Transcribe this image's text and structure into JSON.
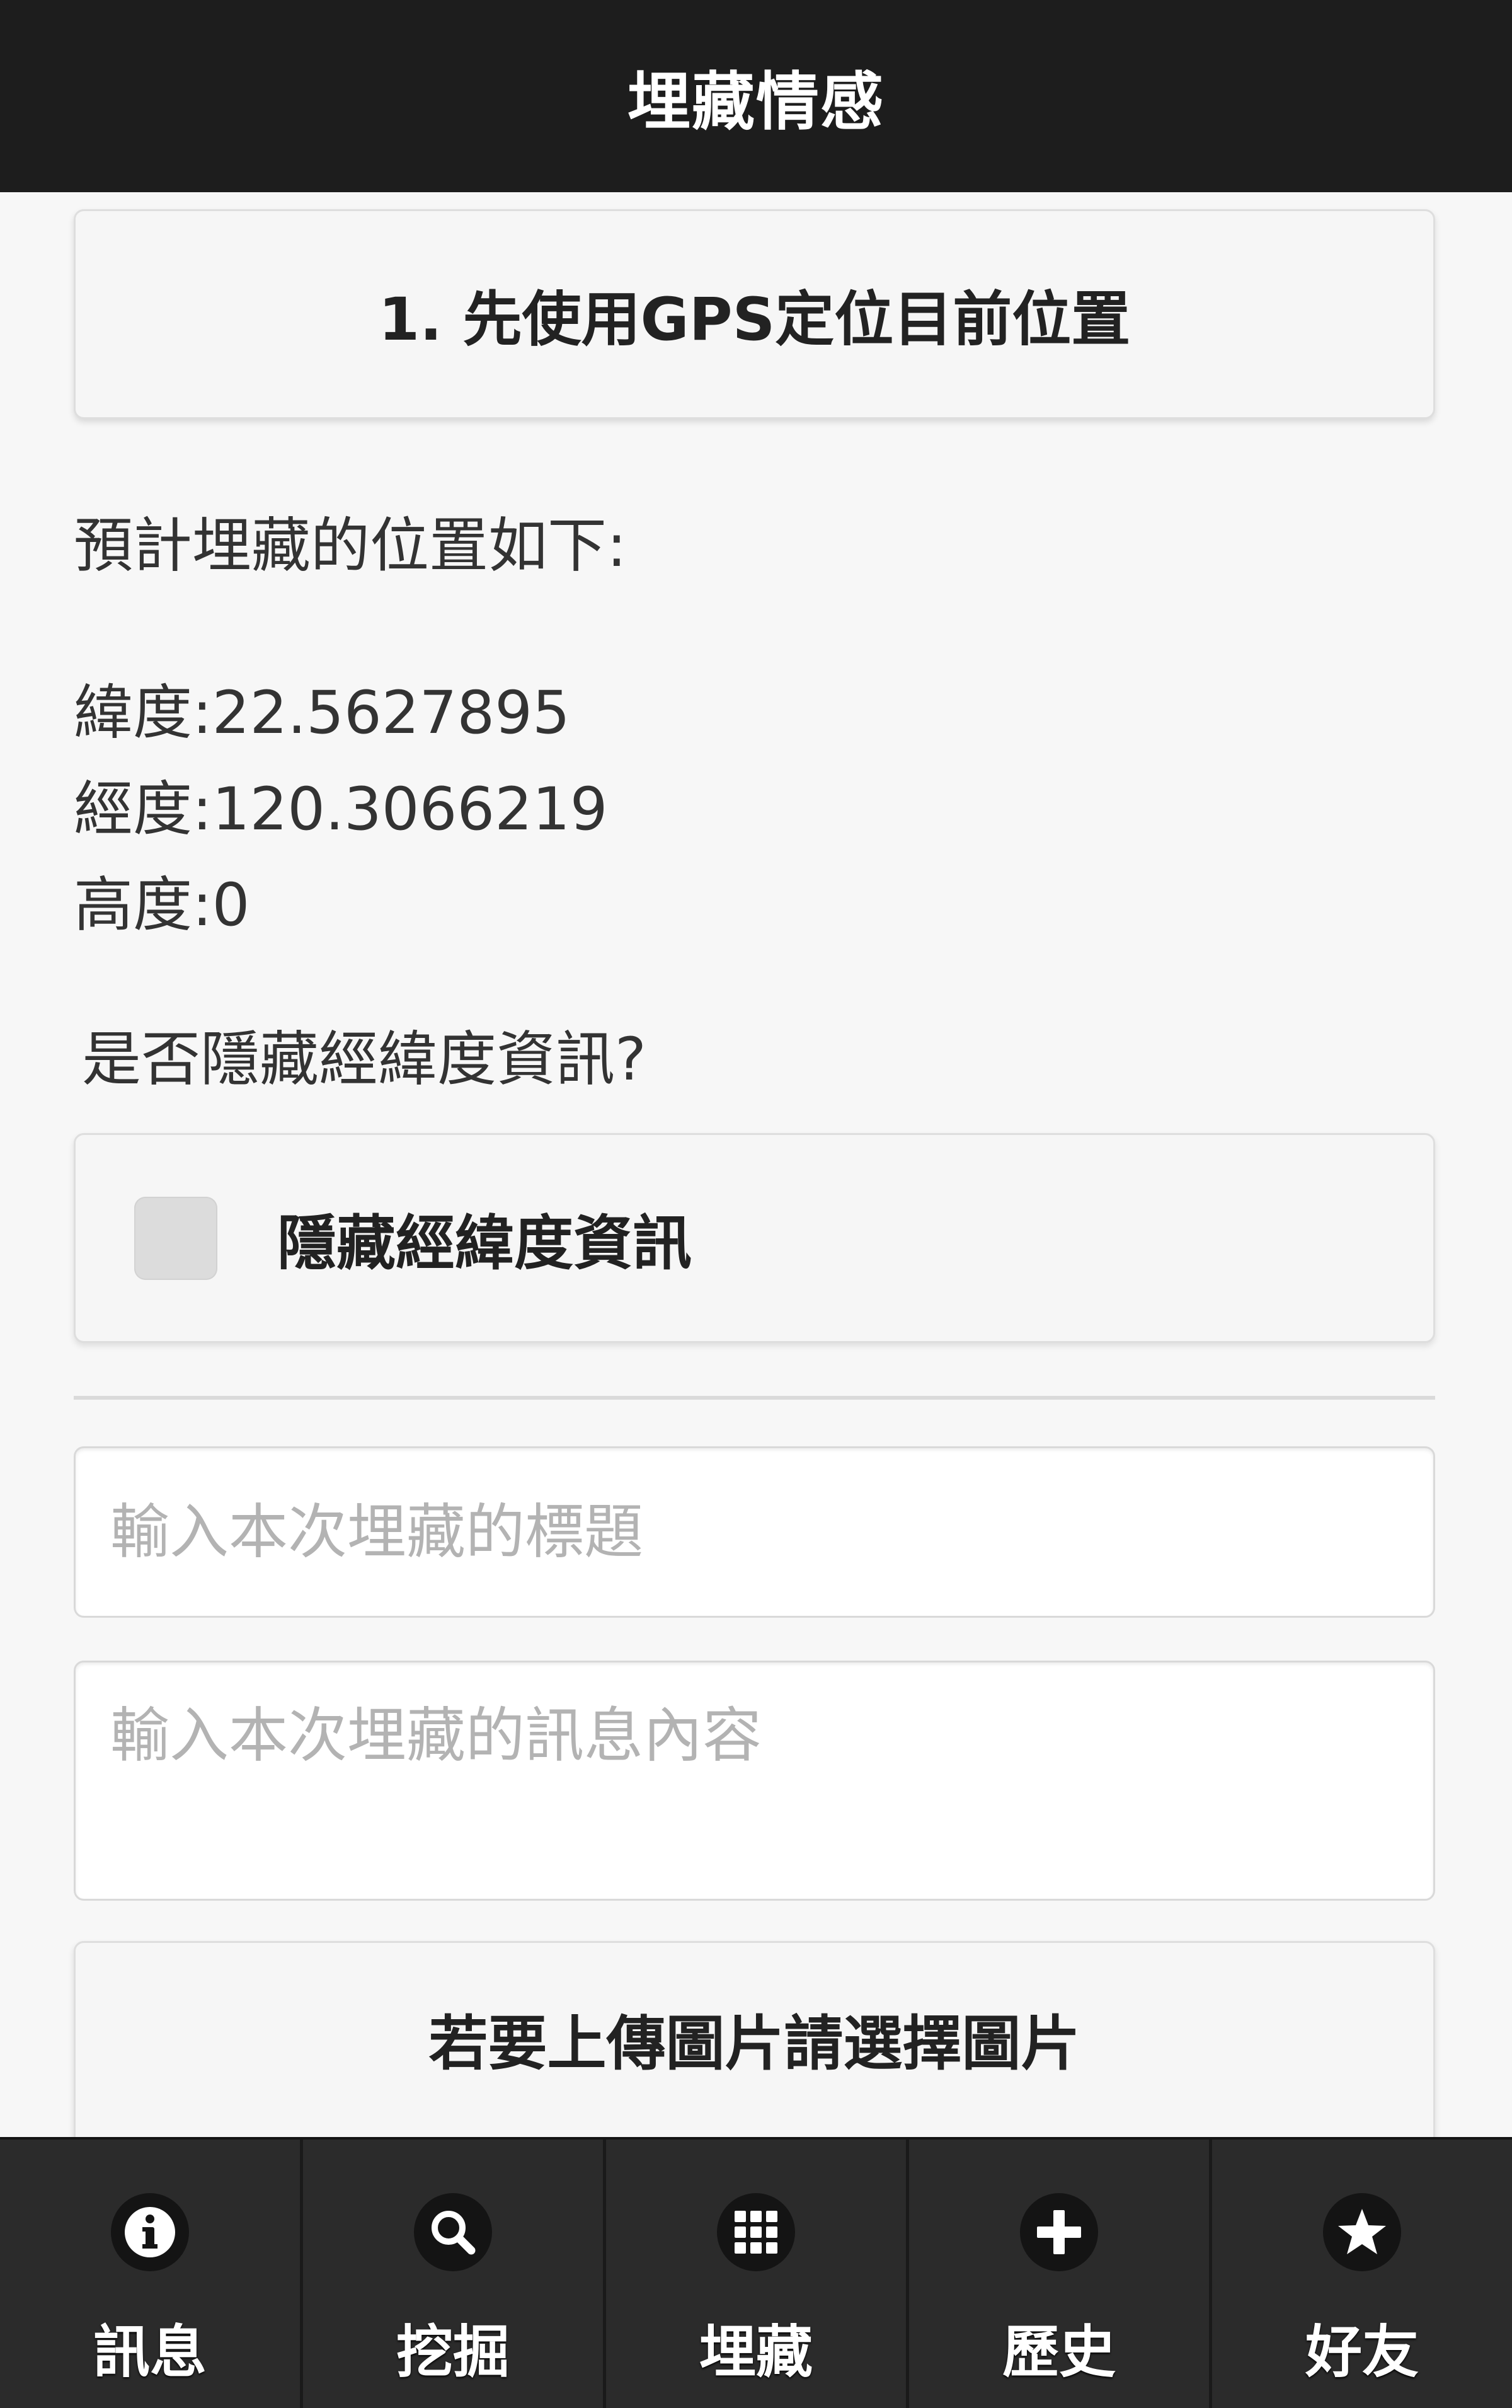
{
  "header": {
    "title": "埋藏情感"
  },
  "gps_button": {
    "label": "1. 先使用GPS定位目前位置"
  },
  "location": {
    "intro": "預計埋藏的位置如下:",
    "latitude": "緯度:22.5627895",
    "longitude": "經度:120.3066219",
    "altitude": "高度:0"
  },
  "hide_option": {
    "question": "是否隱藏經緯度資訊?",
    "checkbox_label": "隱藏經緯度資訊",
    "checked": false
  },
  "form": {
    "title_placeholder": "輸入本次埋藏的標題",
    "message_placeholder": "輸入本次埋藏的訊息內容"
  },
  "upload_button": {
    "label": "若要上傳圖片請選擇圖片"
  },
  "tabbar": {
    "items": [
      {
        "label": "訊息",
        "icon": "info-icon"
      },
      {
        "label": "挖掘",
        "icon": "search-icon"
      },
      {
        "label": "埋藏",
        "icon": "grid-icon"
      },
      {
        "label": "歷史",
        "icon": "plus-icon"
      },
      {
        "label": "好友",
        "icon": "star-icon"
      }
    ]
  }
}
